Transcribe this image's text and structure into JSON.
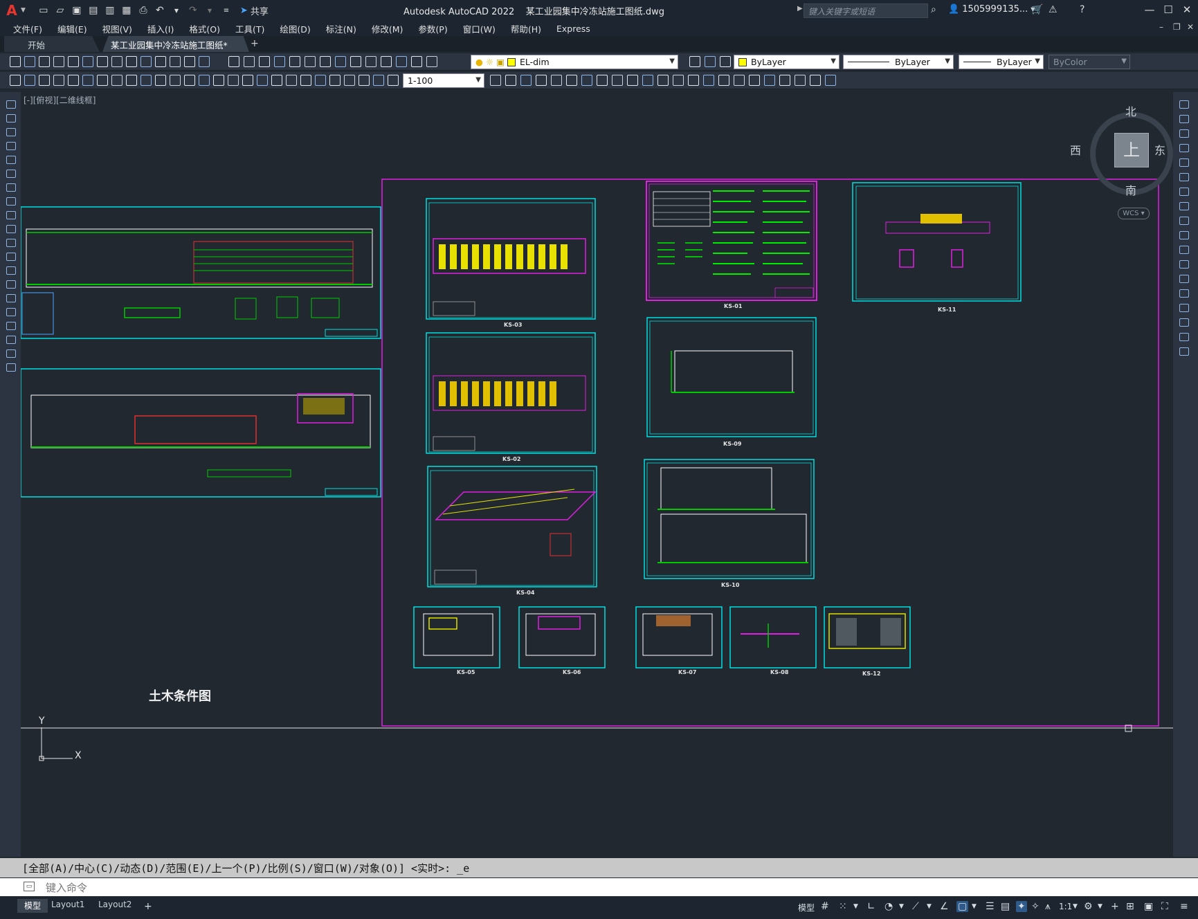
{
  "titlebar": {
    "app_title": "Autodesk AutoCAD 2022    某工业园集中冷冻站施工图纸.dwg",
    "share_label": "共享",
    "search_placeholder": "键入关键字或短语",
    "user_name": "1505999135..."
  },
  "menus": [
    "文件(F)",
    "编辑(E)",
    "视图(V)",
    "插入(I)",
    "格式(O)",
    "工具(T)",
    "绘图(D)",
    "标注(N)",
    "修改(M)",
    "参数(P)",
    "窗口(W)",
    "帮助(H)",
    "Express"
  ],
  "tabs": {
    "start": "开始",
    "active": "某工业园集中冷冻站施工图纸*"
  },
  "toolbar": {
    "layer_name": "EL-dim",
    "color_value": "ByLayer",
    "linetype_value": "ByLayer",
    "lineweight_value": "ByLayer",
    "plotstyle_value": "ByColor",
    "scale_value": "1-100"
  },
  "viewport": {
    "label": "[-][俯视][二维线框]"
  },
  "viewcube": {
    "north": "北",
    "south": "南",
    "east": "东",
    "west": "西",
    "face": "上",
    "wcs": "WCS"
  },
  "drawing": {
    "group_title": "土木条件图",
    "sheet_labels": [
      "KS-03",
      "KS-01",
      "KS-11",
      "KS-02",
      "KS-09",
      "KS-04",
      "KS-10",
      "KS-05",
      "KS-06",
      "KS-07",
      "KS-08",
      "KS-12"
    ],
    "ucs_y": "Y",
    "ucs_x": "X"
  },
  "command": {
    "history": "[全部(A)/中心(C)/动态(D)/范围(E)/上一个(P)/比例(S)/窗口(W)/对象(O)] <实时>: _e",
    "input_placeholder": "键入命令"
  },
  "status": {
    "layout_tabs": [
      "模型",
      "Layout1",
      "Layout2"
    ],
    "model_label": "模型",
    "annotation_scale": "1:1"
  }
}
